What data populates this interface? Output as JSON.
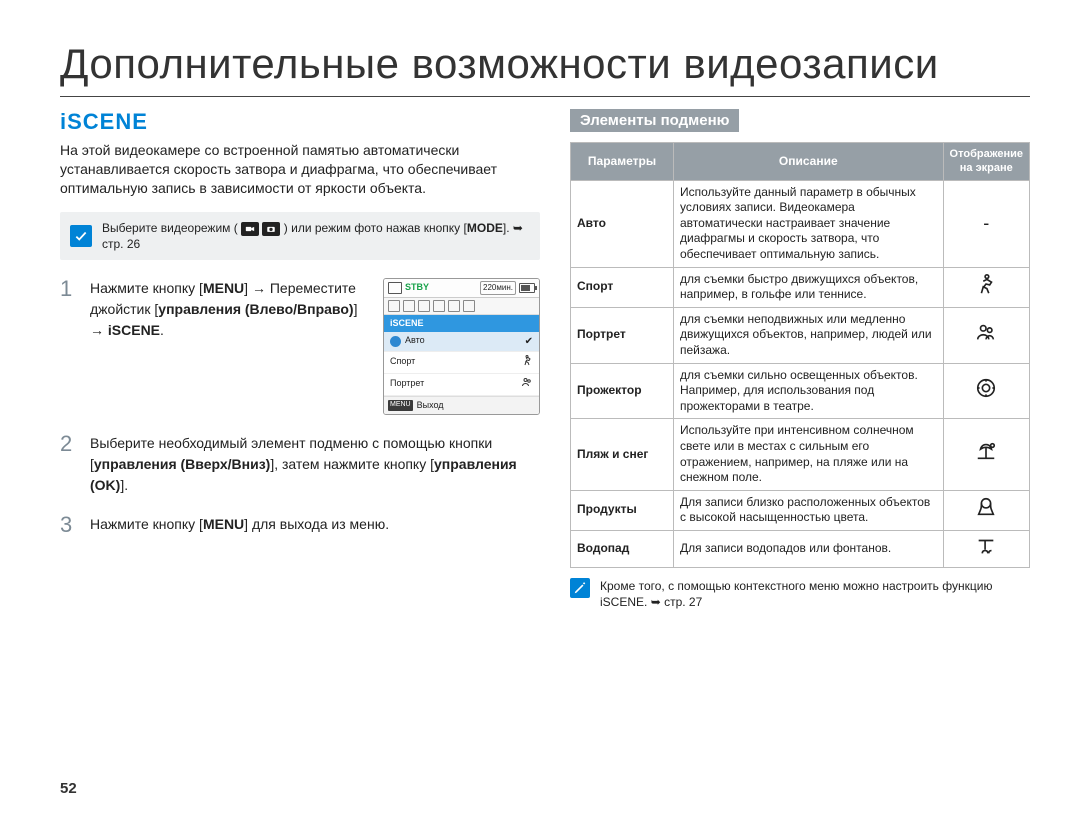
{
  "page_number": "52",
  "main_title": "Дополнительные возможности видеозаписи",
  "section_title": "iSCENE",
  "intro": "На этой видеокамере со встроенной памятью автоматически устанавливается скорость затвора и диафрагма, что обеспечивает оптимальную запись в зависимости от яркости объекта.",
  "notebox": {
    "text_prefix": "Выберите видеорежим (",
    "text_suffix": ") или режим фото нажав кнопку [",
    "mode": "MODE",
    "text_suffix2": "]. ",
    "ref_arrow": "➥",
    "ref": "стр. 26"
  },
  "steps": [
    {
      "num": "1",
      "l1": "Нажмите кнопку [",
      "b1": "MENU",
      "l2": "] → Переместите джойстик [",
      "b2": "управления (Влево/Вправо)",
      "l3": "] → ",
      "b3": "iSCENE",
      "l4": "."
    },
    {
      "num": "2",
      "l1": "Выберите необходимый элемент подменю с помощью кнопки [",
      "b1": "управления (Вверх/Вниз)",
      "l2": "], затем нажмите кнопку [",
      "b2": "управления (OK)",
      "l3": "]."
    },
    {
      "num": "3",
      "l1": "Нажмите кнопку [",
      "b1": "MENU",
      "l2": "] для выхода из меню."
    }
  ],
  "osd": {
    "stby": "STBY",
    "time": "220мин.",
    "category": "iSCENE",
    "items": [
      {
        "label": "Авто",
        "selected": true
      },
      {
        "label": "Спорт",
        "selected": false
      },
      {
        "label": "Портрет",
        "selected": false
      }
    ],
    "menu_label": "MENU",
    "exit": "Выход"
  },
  "submenu_header": "Элементы подменю",
  "submenu_headers": {
    "param": "Параметры",
    "desc": "Описание",
    "disp_l1": "Отображение",
    "disp_l2": "на экране"
  },
  "submenu_rows": [
    {
      "param": "Авто",
      "desc": "Используйте данный параметр в обычных условиях записи. Видеокамера автоматически настраивает значение диафрагмы и скорость затвора, что обеспечивает оптимальную запись.",
      "icon": "-"
    },
    {
      "param": "Спорт",
      "desc": "для съемки быстро движущихся объектов, например, в гольфе или теннисе.",
      "icon": "sport"
    },
    {
      "param": "Портрет",
      "desc": "для съемки неподвижных или медленно движущихся объектов, например, людей или пейзажа.",
      "icon": "portrait"
    },
    {
      "param": "Прожектор",
      "desc": "для съемки сильно освещенных объектов. Например, для использования под прожекторами в театре.",
      "icon": "spotlight"
    },
    {
      "param": "Пляж и снег",
      "desc": "Используйте при интенсивном солнечном свете или в местах с сильным его отражением, например, на пляже или на снежном поле.",
      "icon": "beach"
    },
    {
      "param": "Продукты",
      "desc": "Для записи близко расположенных объектов с высокой насыщенностью цвета.",
      "icon": "food"
    },
    {
      "param": "Водопад",
      "desc": "Для записи водопадов или фонтанов.",
      "icon": "waterfall"
    }
  ],
  "footnote": {
    "text": "Кроме того, с помощью контекстного меню можно настроить функцию iSCENE. ",
    "ref_arrow": "➥",
    "ref": "стр. 27"
  },
  "icons": {
    "video": "video-icon",
    "photo": "photo-icon",
    "check": "✓",
    "pencil": "✎"
  }
}
